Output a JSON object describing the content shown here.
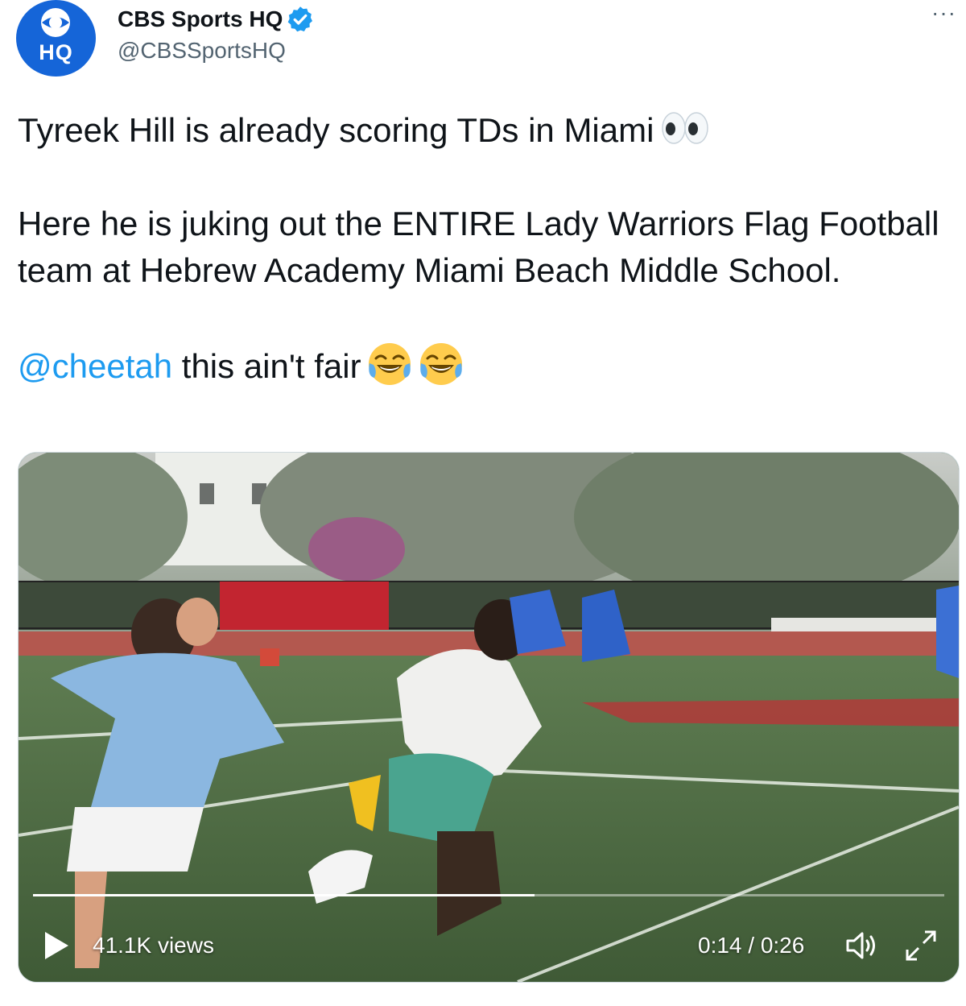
{
  "author": {
    "display_name": "CBS Sports HQ",
    "handle": "@CBSSportsHQ",
    "avatar_text": "HQ",
    "verified": true
  },
  "more_label": "···",
  "tweet_text": {
    "line1": "Tyreek Hill is already scoring TDs in Miami",
    "paragraph2": "Here he is juking out the ENTIRE Lady Warriors Flag Football team at Hebrew Academy Miami Beach Middle School.",
    "mention": "@cheetah",
    "line3_rest": " this ain't fair"
  },
  "video": {
    "views": "41.1K views",
    "time": "0:14 / 0:26",
    "progress": 0.55
  },
  "colors": {
    "accent": "#1d9bf0",
    "avatar_bg": "#1565d8",
    "text": "#0f1419",
    "secondary": "#536471"
  },
  "icons": [
    "verified-badge-icon",
    "more-icon",
    "eyes-emoji-icon",
    "laughing-emoji-icon",
    "play-icon",
    "volume-icon",
    "fullscreen-icon"
  ]
}
